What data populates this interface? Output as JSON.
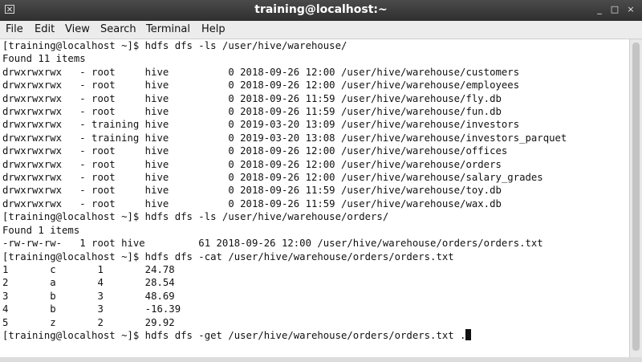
{
  "window": {
    "title": "training@localhost:~",
    "controls": {
      "minimize": "_",
      "maximize": "□",
      "close": "×"
    }
  },
  "menubar": {
    "items": [
      "File",
      "Edit",
      "View",
      "Search",
      "Terminal",
      "Help"
    ]
  },
  "terminal": {
    "lines": [
      "[training@localhost ~]$ hdfs dfs -ls /user/hive/warehouse/",
      "Found 11 items",
      "drwxrwxrwx   - root     hive          0 2018-09-26 12:00 /user/hive/warehouse/customers",
      "drwxrwxrwx   - root     hive          0 2018-09-26 12:00 /user/hive/warehouse/employees",
      "drwxrwxrwx   - root     hive          0 2018-09-26 11:59 /user/hive/warehouse/fly.db",
      "drwxrwxrwx   - root     hive          0 2018-09-26 11:59 /user/hive/warehouse/fun.db",
      "drwxrwxrwx   - training hive          0 2019-03-20 13:09 /user/hive/warehouse/investors",
      "drwxrwxrwx   - training hive          0 2019-03-20 13:08 /user/hive/warehouse/investors_parquet",
      "drwxrwxrwx   - root     hive          0 2018-09-26 12:00 /user/hive/warehouse/offices",
      "drwxrwxrwx   - root     hive          0 2018-09-26 12:00 /user/hive/warehouse/orders",
      "drwxrwxrwx   - root     hive          0 2018-09-26 12:00 /user/hive/warehouse/salary_grades",
      "drwxrwxrwx   - root     hive          0 2018-09-26 11:59 /user/hive/warehouse/toy.db",
      "drwxrwxrwx   - root     hive          0 2018-09-26 11:59 /user/hive/warehouse/wax.db",
      "[training@localhost ~]$ hdfs dfs -ls /user/hive/warehouse/orders/",
      "Found 1 items",
      "-rw-rw-rw-   1 root hive         61 2018-09-26 12:00 /user/hive/warehouse/orders/orders.txt",
      "[training@localhost ~]$ hdfs dfs -cat /user/hive/warehouse/orders/orders.txt",
      "1       c       1       24.78",
      "2       a       4       28.54",
      "3       b       3       48.69",
      "4       b       3       -16.39",
      "5       z       2       29.92",
      "[training@localhost ~]$ hdfs dfs -get /user/hive/warehouse/orders/orders.txt ."
    ]
  }
}
